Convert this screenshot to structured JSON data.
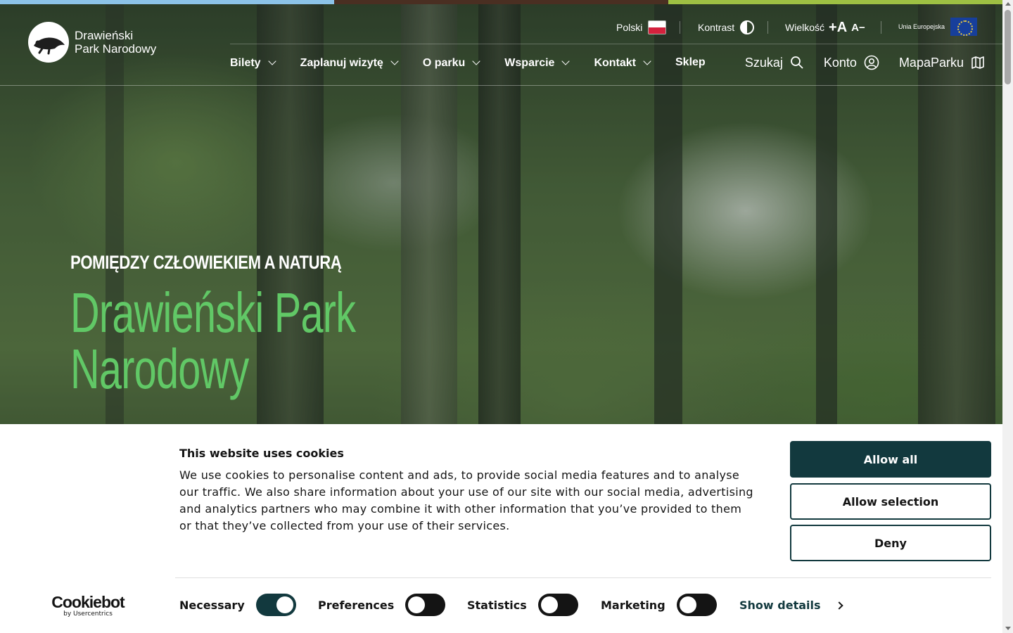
{
  "header": {
    "logo": {
      "line1": "Drawieński",
      "line2": "Park Narodowy"
    },
    "utility": {
      "language_label": "Polski",
      "contrast_label": "Kontrast",
      "size_label": "Wielkość",
      "size_increase": "+A",
      "size_decrease": "A−",
      "eu_label": "Unia Europejska"
    },
    "nav": [
      {
        "label": "Bilety",
        "has_dropdown": true
      },
      {
        "label": "Zaplanuj wizytę",
        "has_dropdown": true
      },
      {
        "label": "O parku",
        "has_dropdown": true
      },
      {
        "label": "Wsparcie",
        "has_dropdown": true
      },
      {
        "label": "Kontakt",
        "has_dropdown": true
      },
      {
        "label": "Sklep",
        "has_dropdown": false
      }
    ],
    "tools": {
      "search_label": "Szukaj",
      "account_label": "Konto",
      "map_label": "MapaParku"
    }
  },
  "hero": {
    "eyebrow": "POMIĘDZY CZŁOWIEKIEM A NATURĄ",
    "title_line1": "Drawieński Park",
    "title_line2": "Narodowy"
  },
  "cookie_banner": {
    "title": "This website uses cookies",
    "text": "We use cookies to personalise content and ads, to provide social media features and to analyse our traffic. We also share information about your use of our site with our social media, advertising and analytics partners who may combine it with other information that you’ve provided to them or that they’ve collected from your use of their services.",
    "buttons": {
      "allow_all": "Allow all",
      "allow_selection": "Allow selection",
      "deny": "Deny"
    },
    "toggles": [
      {
        "label": "Necessary",
        "on": true
      },
      {
        "label": "Preferences",
        "on": false
      },
      {
        "label": "Statistics",
        "on": false
      },
      {
        "label": "Marketing",
        "on": false
      }
    ],
    "show_details": "Show details",
    "brand": {
      "name": "Cookiebot",
      "by": "by Usercentrics"
    }
  },
  "colors": {
    "stripe_blue": "#8cc3e8",
    "stripe_brown": "#4a2f22",
    "stripe_green": "#9ec043",
    "title_green": "#61c866",
    "cookie_primary": "#12393e"
  }
}
